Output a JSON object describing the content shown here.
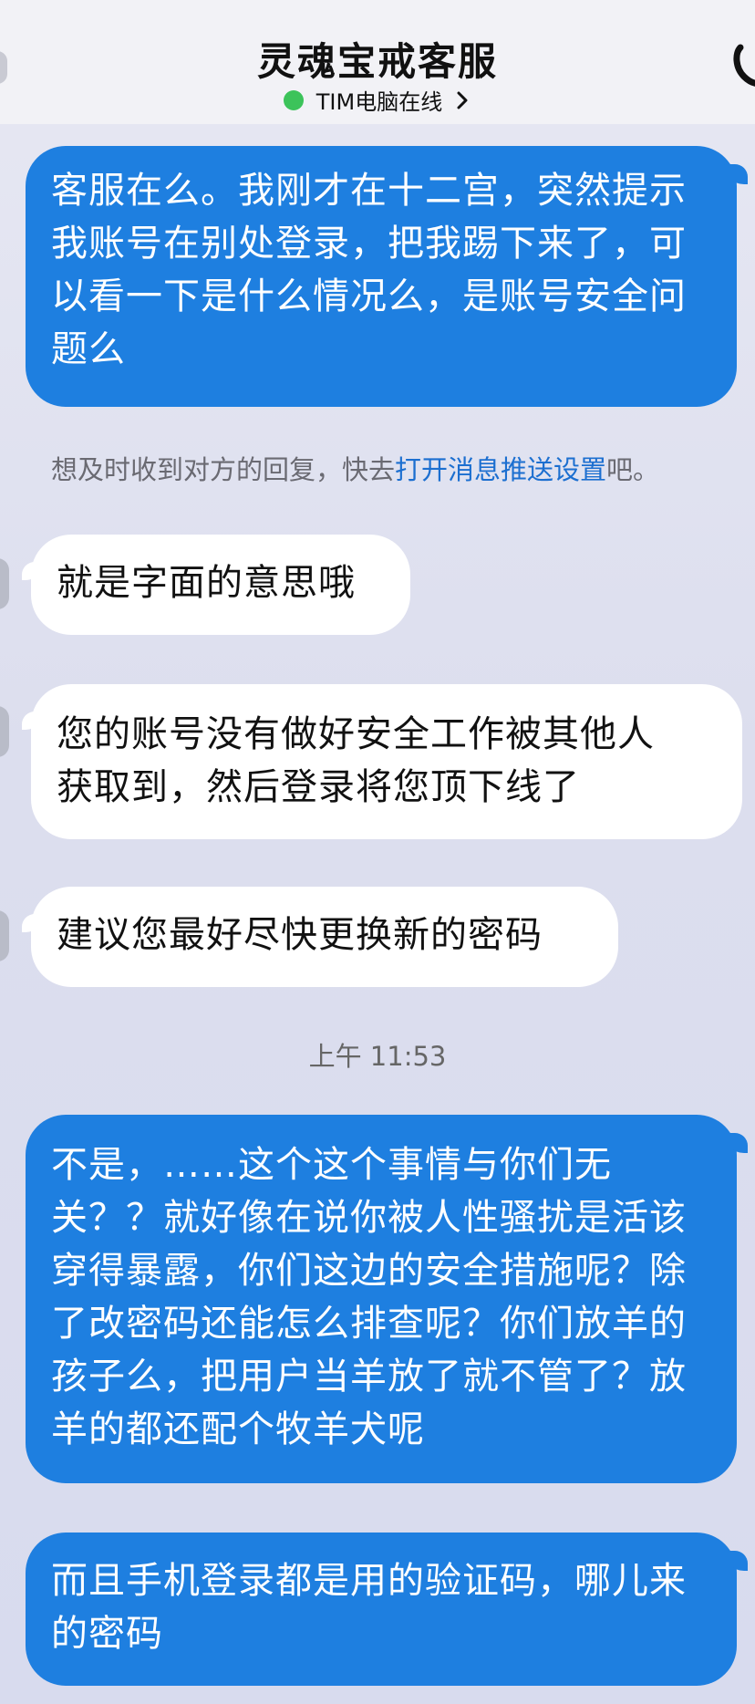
{
  "header": {
    "title": "灵魂宝戒客服",
    "status_text": "TIM电脑在线",
    "status_color": "#3cc35a"
  },
  "messages": {
    "m1": "客服在么。我刚才在十二宫，突然提示我账号在别处登录，把我踢下来了，可以看一下是什么情况么，是账号安全问题么",
    "m2": "就是字面的意思哦",
    "m3_line1": "您的账号没有做好安全工作被其他人",
    "m3_line2": "获取到，然后登录将您顶下线了",
    "m4": "建议您最好尽快更换新的密码",
    "m5": "不是，……这个这个事情与你们无关？？就好像在说你被人性骚扰是活该穿得暴露，你们这边的安全措施呢？除了改密码还能怎么排查呢？你们放羊的孩子么，把用户当羊放了就不管了？放羊的都还配个牧羊犬呢",
    "m6": "而且手机登录都是用的验证码，哪儿来的密码"
  },
  "notice": {
    "prefix": "想及时收到对方的回复，快去",
    "link": "打开消息推送设置",
    "suffix": "吧。"
  },
  "timestamp": "上午 11:53",
  "colors": {
    "outgoing_bubble": "#1e7fe0",
    "incoming_bubble": "#ffffff",
    "link": "#1c6fd0"
  }
}
